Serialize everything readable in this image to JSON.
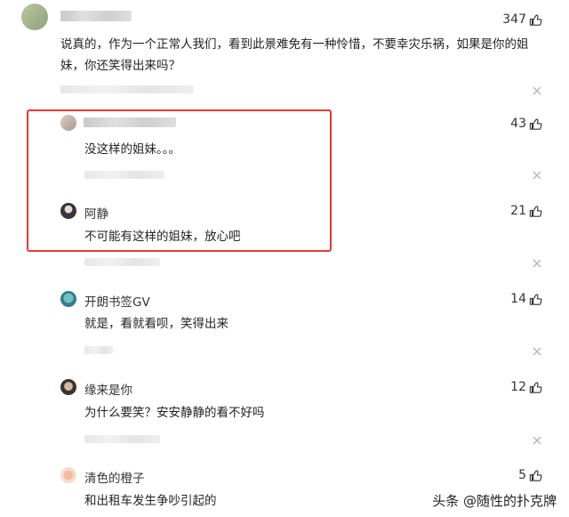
{
  "comments": [
    {
      "likes": "347",
      "text_line1": "说真的，作为一个正常人我们，看到此景难免有一种怜惜，不要幸灾乐祸，如果是你的姐",
      "text_line2": "妹，你还笑得出来吗？"
    },
    {
      "likes": "43",
      "text": "没这样的姐妹。。。"
    },
    {
      "name": "阿静",
      "likes": "21",
      "text": "不可能有这样的姐妹，放心吧"
    },
    {
      "name": "开朗书签GV",
      "likes": "14",
      "text": "就是，看就看呗，笑得出来"
    },
    {
      "name": "缘来是你",
      "likes": "12",
      "text": "为什么要笑？安安静静的看不好吗"
    },
    {
      "name": "清色的橙子",
      "likes": "5",
      "text": "和出租车发生争吵引起的"
    }
  ],
  "watermark": "头条 @随性的扑克牌",
  "colors": {
    "highlight": "#e53935",
    "text": "#222222",
    "secondary": "#999999"
  }
}
